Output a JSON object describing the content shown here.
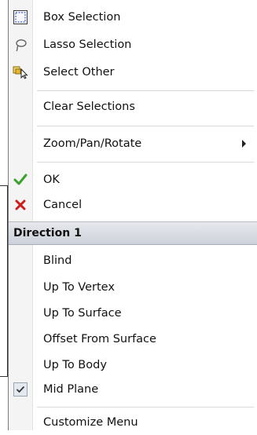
{
  "menu": {
    "selection": {
      "box": "Box Selection",
      "lasso": "Lasso Selection",
      "other": "Select Other"
    },
    "clear": "Clear Selections",
    "zoom": "Zoom/Pan/Rotate",
    "ok": "OK",
    "cancel": "Cancel",
    "section_title": "Direction 1",
    "direction": {
      "blind": "Blind",
      "vertex": "Up To Vertex",
      "surface": "Up To Surface",
      "offset": "Offset From Surface",
      "body": "Up To Body",
      "midplane": "Mid Plane",
      "midplane_checked": true
    },
    "customize": "Customize Menu"
  },
  "colors": {
    "ok_check": "#3aa12e",
    "cancel_x": "#d11a1a",
    "header_gradient_top": "#e6e8ed",
    "header_gradient_bottom": "#cdd1d9"
  },
  "icons": {
    "box": "box-selection-icon",
    "lasso": "lasso-icon",
    "other": "select-other-icon",
    "ok": "checkmark-icon",
    "cancel": "x-icon",
    "submenu": "submenu-arrow-icon",
    "check": "checkbox-check-icon"
  }
}
